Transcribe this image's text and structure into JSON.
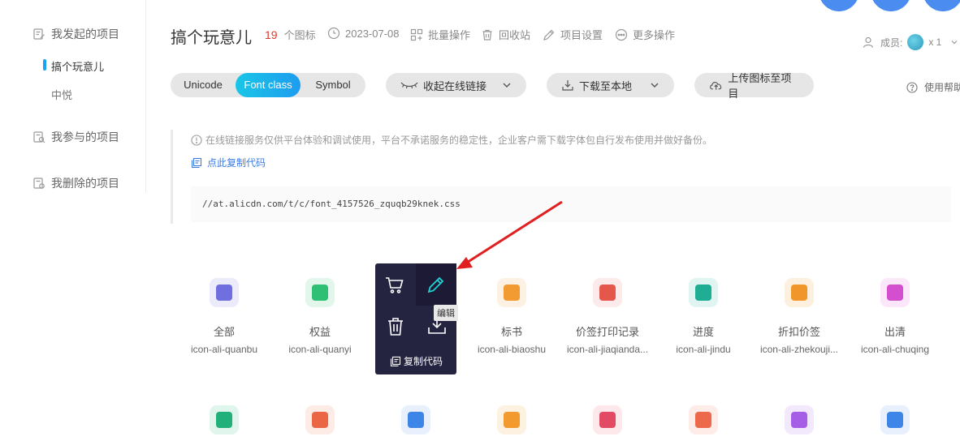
{
  "sidebar": {
    "my_projects": "我发起的项目",
    "project_items": [
      "搞个玩意儿",
      "中悦"
    ],
    "joined_projects": "我参与的项目",
    "deleted_projects": "我删除的项目"
  },
  "header": {
    "title": "搞个玩意儿",
    "icon_count": "19",
    "icon_count_unit": "个图标",
    "date": "2023-07-08",
    "batch": "批量操作",
    "recycle": "回收站",
    "settings": "项目设置",
    "more": "更多操作",
    "members_label": "成员:",
    "members_count": "x 1"
  },
  "toolbar": {
    "seg_unicode": "Unicode",
    "seg_fontclass": "Font class",
    "seg_symbol": "Symbol",
    "collapse_link": "收起在线链接",
    "download_local": "下载至本地",
    "upload_icon": "上传图标至项目",
    "help": "使用帮助"
  },
  "notice": {
    "text": "在线链接服务仅供平台体验和调试使用，平台不承诺服务的稳定性，企业客户需下载字体包自行发布使用并做好备份。",
    "copy_link": "点此复制代码",
    "code": "//at.alicdn.com/t/c/font_4157526_zquqb29knek.css"
  },
  "icons_row1": [
    {
      "name": "全部",
      "code": "icon-ali-quanbu",
      "bg": "#ebebfb",
      "fg": "#6f6fe0"
    },
    {
      "name": "权益",
      "code": "icon-ali-quanyi",
      "bg": "#e3f6ec",
      "fg": "#2fbf75"
    },
    {
      "name": "",
      "code": "",
      "bg": "#e9eefb",
      "fg": "#4a7ee8"
    },
    {
      "name": "标书",
      "code": "icon-ali-biaoshu",
      "bg": "#fdf1e3",
      "fg": "#f29b32"
    },
    {
      "name": "价签打印记录",
      "code": "icon-ali-jiaqianda...",
      "bg": "#fdeaea",
      "fg": "#e5574b"
    },
    {
      "name": "进度",
      "code": "icon-ali-jindu",
      "bg": "#e0f5f1",
      "fg": "#1fae93"
    },
    {
      "name": "折扣价签",
      "code": "icon-ali-zhekouji...",
      "bg": "#fdf0de",
      "fg": "#f0962a"
    },
    {
      "name": "出清",
      "code": "icon-ali-chuqing",
      "bg": "#fbe7f9",
      "fg": "#d44fd0"
    }
  ],
  "icons_row2": [
    {
      "bg": "#e0f5ec",
      "fg": "#22b07a"
    },
    {
      "bg": "#fdebe6",
      "fg": "#ea6645"
    },
    {
      "bg": "#e7f0fc",
      "fg": "#3d86e8"
    },
    {
      "bg": "#fdf1e2",
      "fg": "#f39a2e"
    },
    {
      "bg": "#fde9ec",
      "fg": "#e34a63"
    },
    {
      "bg": "#fdece7",
      "fg": "#ec6a4b"
    },
    {
      "bg": "#f3e9fc",
      "fg": "#a55ee5"
    },
    {
      "bg": "#e7f0fc",
      "fg": "#3d86e8"
    }
  ],
  "popup": {
    "copy_code": "复制代码",
    "tooltip": "编辑"
  }
}
